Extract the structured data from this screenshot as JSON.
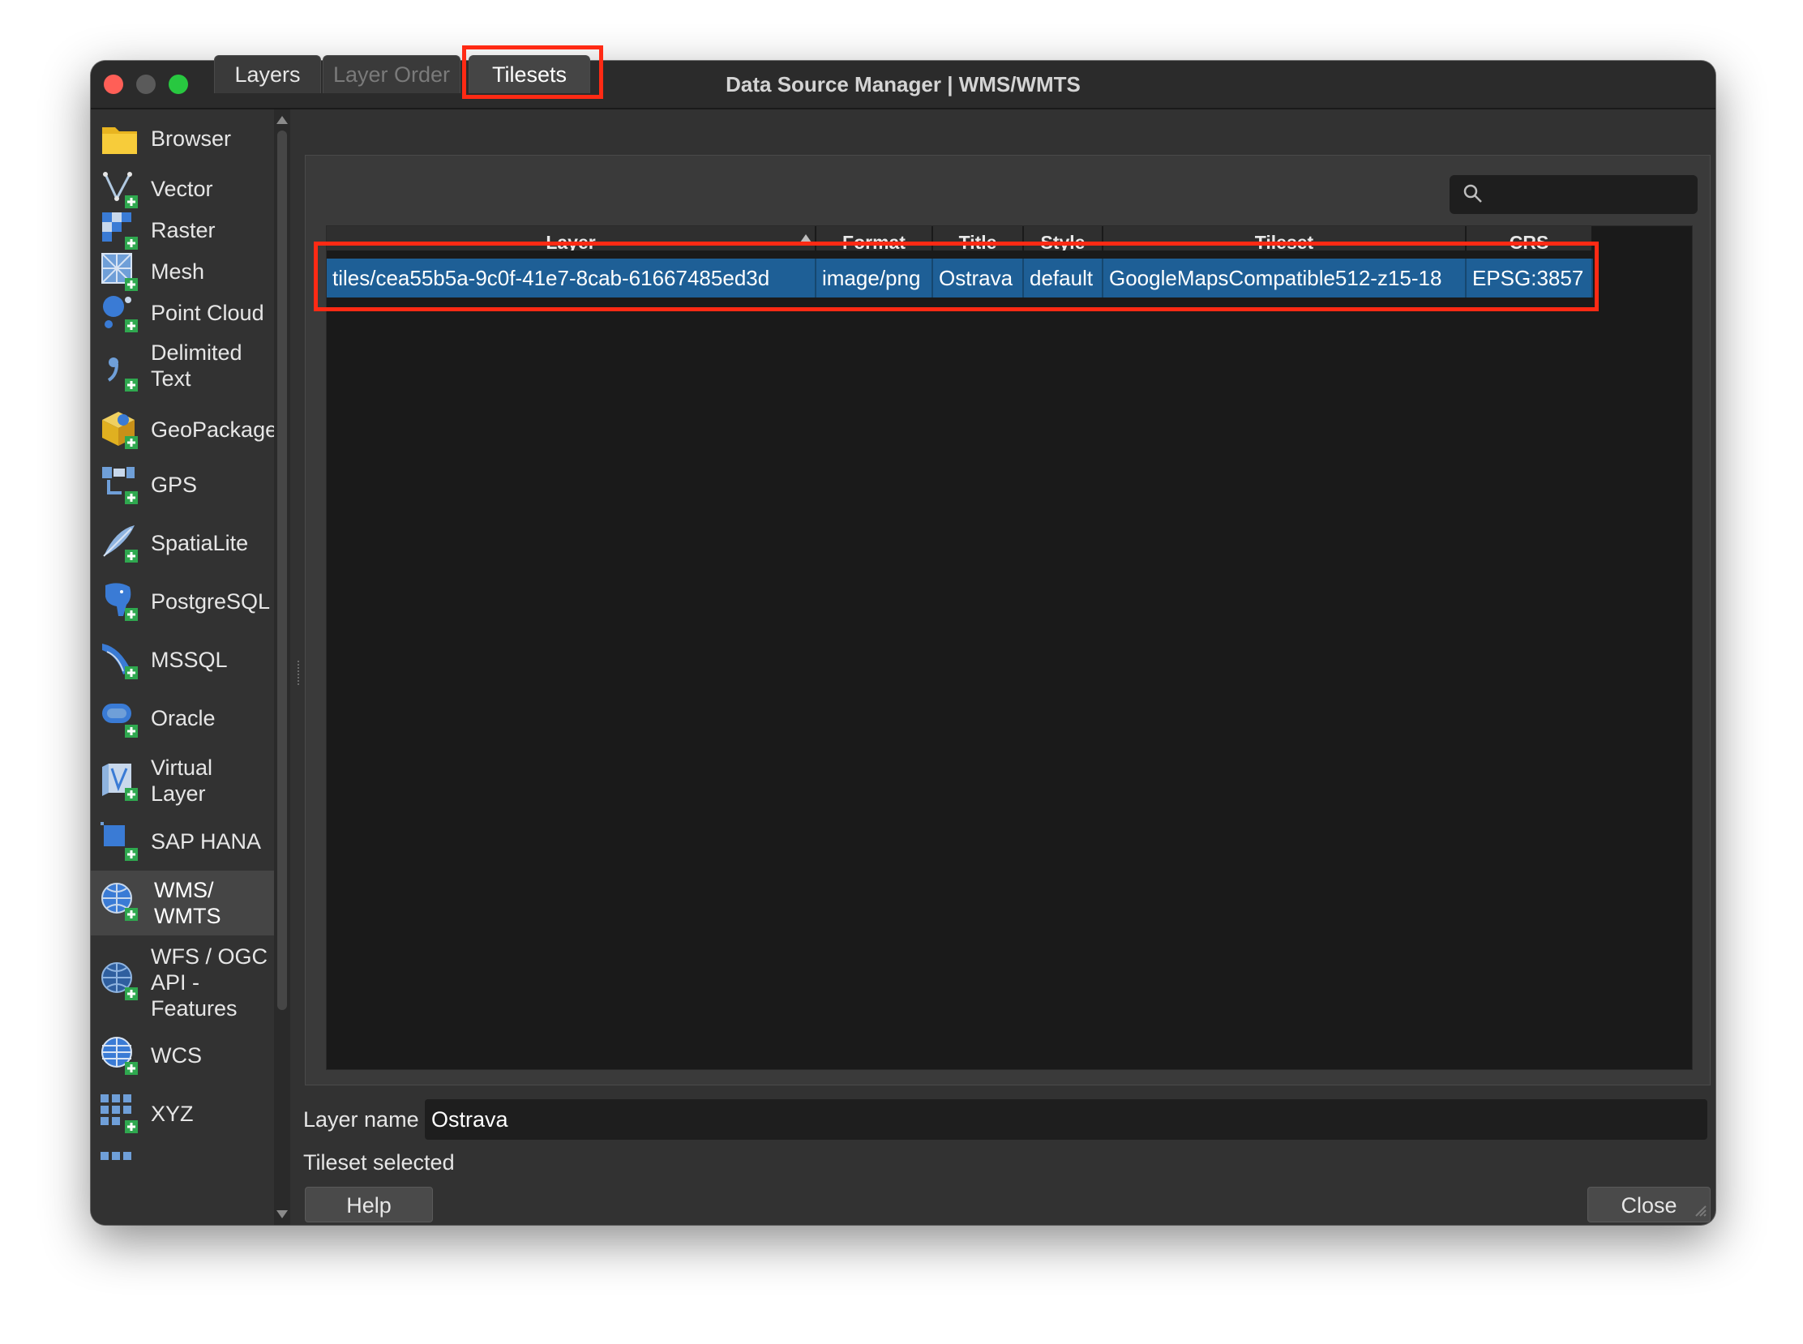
{
  "window": {
    "title": "Data Source Manager | WMS/WMTS"
  },
  "sidebar": {
    "items": [
      {
        "label": "Browser",
        "icon": "folder-icon"
      },
      {
        "label": "Vector",
        "icon": "vector-add-icon"
      },
      {
        "label": "Raster",
        "icon": "raster-add-icon"
      },
      {
        "label": "Mesh",
        "icon": "mesh-add-icon"
      },
      {
        "label": "Point Cloud",
        "icon": "point-cloud-add-icon"
      },
      {
        "label": "Delimited\nText",
        "icon": "delimited-text-add-icon"
      },
      {
        "label": "GeoPackage",
        "icon": "geopackage-add-icon"
      },
      {
        "label": "GPS",
        "icon": "gps-add-icon"
      },
      {
        "label": "SpatiaLite",
        "icon": "spatialite-add-icon"
      },
      {
        "label": "PostgreSQL",
        "icon": "postgresql-add-icon"
      },
      {
        "label": "MSSQL",
        "icon": "mssql-add-icon"
      },
      {
        "label": "Oracle",
        "icon": "oracle-add-icon"
      },
      {
        "label": "Virtual\nLayer",
        "icon": "virtual-layer-add-icon"
      },
      {
        "label": "SAP HANA",
        "icon": "sap-hana-add-icon"
      },
      {
        "label": "WMS/\nWMTS",
        "icon": "wms-globe-icon"
      },
      {
        "label": "WFS / OGC\nAPI -\nFeatures",
        "icon": "wfs-globe-icon"
      },
      {
        "label": "WCS",
        "icon": "wcs-globe-icon"
      },
      {
        "label": "XYZ",
        "icon": "xyz-grid-icon"
      }
    ],
    "active_index": 14
  },
  "tabs": [
    {
      "label": "Layers"
    },
    {
      "label": "Layer Order"
    },
    {
      "label": "Tilesets"
    }
  ],
  "search": {
    "placeholder": ""
  },
  "table": {
    "columns": [
      "Layer",
      "Format",
      "Title",
      "Style",
      "Tileset",
      "CRS"
    ],
    "rows": [
      [
        "tiles/cea55b5a-9c0f-41e7-8cab-61667485ed3d",
        "image/png",
        "Ostrava",
        "default",
        "GoogleMapsCompatible512-z15-18",
        "EPSG:3857"
      ]
    ]
  },
  "layer_name": {
    "label": "Layer name",
    "value": "Ostrava"
  },
  "status": "Tileset selected",
  "buttons": {
    "help": "Help",
    "close": "Close"
  },
  "colors": {
    "selection": "#1e5f96",
    "highlight": "#ff2a14",
    "background": "#323232"
  }
}
